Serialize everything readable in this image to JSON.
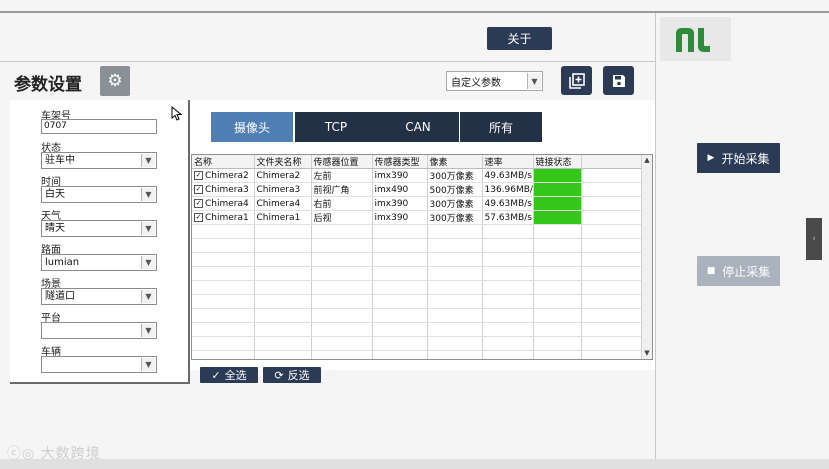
{
  "header": {
    "about_label": "关于",
    "logo_text": "nI",
    "logo_color": "#2e8b3a"
  },
  "title_bar": {
    "title": "参数设置",
    "settings_icon": "gear-icon",
    "preset_value": "自定义参数",
    "add_icon": "add-box-icon",
    "save_icon": "save-icon"
  },
  "form": {
    "fields": [
      {
        "label": "车架号",
        "value": "0707"
      },
      {
        "label": "状态",
        "value": "驻车中"
      },
      {
        "label": "时间",
        "value": "白天"
      },
      {
        "label": "天气",
        "value": "晴天"
      },
      {
        "label": "路面",
        "value": "lumian"
      },
      {
        "label": "场景",
        "value": "隧道口"
      },
      {
        "label": "平台",
        "value": ""
      },
      {
        "label": "车辆",
        "value": ""
      }
    ]
  },
  "tabs": [
    {
      "label": "摄像头",
      "active": true
    },
    {
      "label": "TCP",
      "active": false
    },
    {
      "label": "CAN",
      "active": false
    },
    {
      "label": "所有",
      "active": false
    }
  ],
  "table": {
    "headers": [
      "名称",
      "文件夹名称",
      "传感器位置",
      "传感器类型",
      "像素",
      "速率",
      "链接状态"
    ],
    "rows": [
      {
        "checked": true,
        "name": "Chimera2",
        "folder": "Chimera2",
        "position": "左前",
        "type": "imx390",
        "pixels": "300万像素",
        "rate": "49.63MB/s",
        "status": "connected"
      },
      {
        "checked": true,
        "name": "Chimera3",
        "folder": "Chimera3",
        "position": "前视广角",
        "type": "imx490",
        "pixels": "500万像素",
        "rate": "136.96MB/s",
        "status": "connected"
      },
      {
        "checked": true,
        "name": "Chimera4",
        "folder": "Chimera4",
        "position": "右前",
        "type": "imx390",
        "pixels": "300万像素",
        "rate": "49.63MB/s",
        "status": "connected"
      },
      {
        "checked": true,
        "name": "Chimera1",
        "folder": "Chimera1",
        "position": "后视",
        "type": "imx390",
        "pixels": "300万像素",
        "rate": "57.63MB/s",
        "status": "connected"
      }
    ],
    "status_color": "#35c61a"
  },
  "actions": {
    "select_all": "全选",
    "invert": "反选",
    "start": "开始采集",
    "stop": "停止采集"
  },
  "colors": {
    "primary": "#2b3a55",
    "tab_active": "#4f7fb5",
    "stop_disabled": "#a9b2bd"
  },
  "watermark": "ⓒ◎ 大数跨境"
}
